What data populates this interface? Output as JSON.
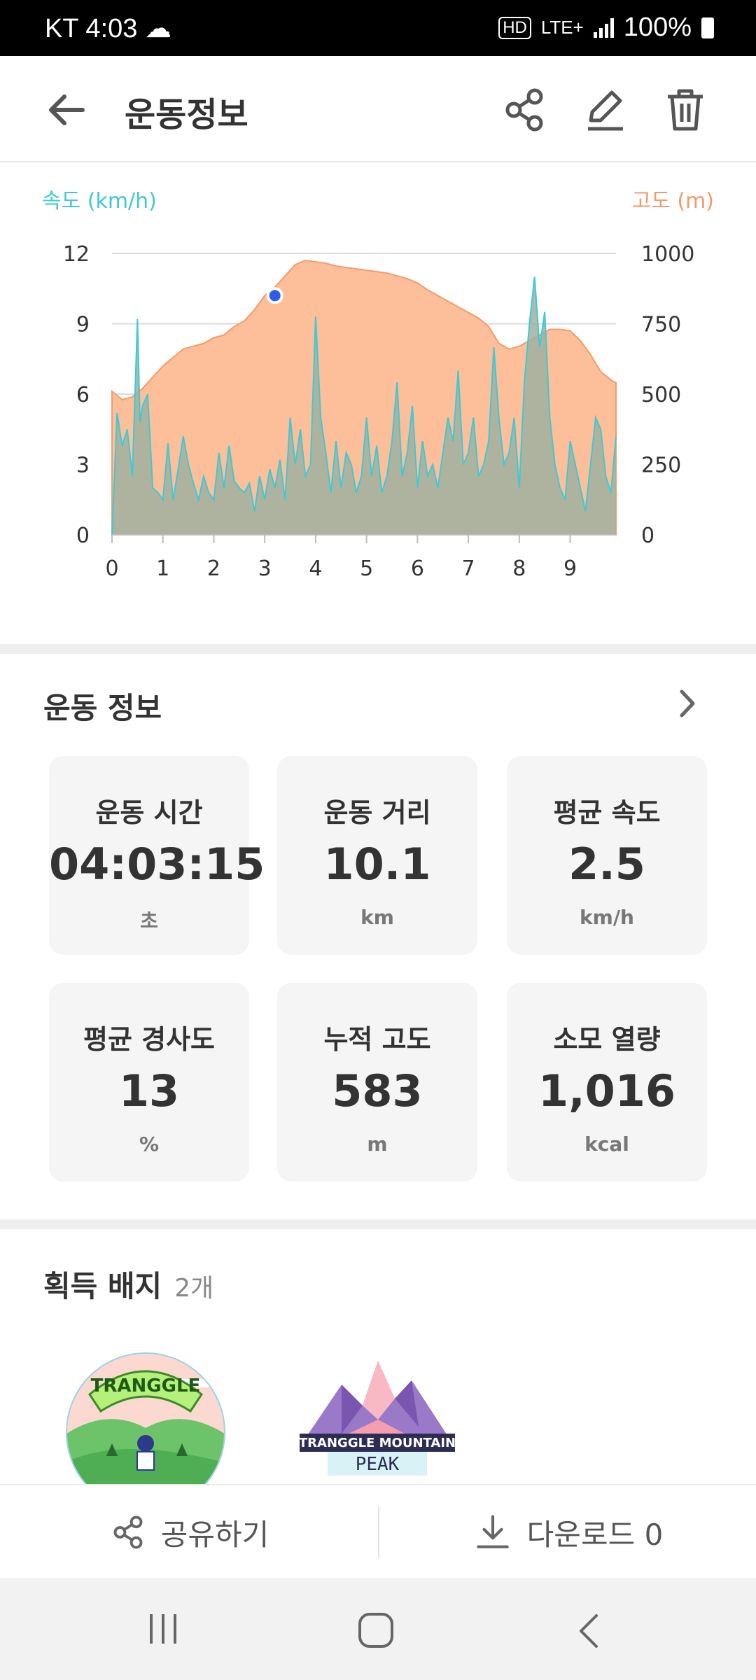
{
  "status_bar": {
    "carrier_time": "KT 4:03",
    "hd": "HD",
    "network": "LTE+",
    "battery": "100%"
  },
  "header": {
    "title": "운동정보",
    "back_icon": "arrow-left-icon",
    "share_icon": "share-icon",
    "edit_icon": "pencil-icon",
    "delete_icon": "trash-icon"
  },
  "chart_data": {
    "type": "area",
    "left_axis_label": "속도 (km/h)",
    "right_axis_label": "고도 (m)",
    "x_ticks": [
      "0",
      "1",
      "2",
      "3",
      "4",
      "5",
      "6",
      "7",
      "8",
      "9"
    ],
    "x_range": [
      0,
      9.9
    ],
    "left_ticks": [
      "0",
      "3",
      "6",
      "9",
      "12"
    ],
    "left_range": [
      0,
      12
    ],
    "right_ticks": [
      "0",
      "250",
      "500",
      "750",
      "1000"
    ],
    "right_range": [
      0,
      1000
    ],
    "colors": {
      "speed_line": "#3ec9d6",
      "speed_fill": "#9fb0a0",
      "altitude_fill": "#fdbf9a",
      "altitude_line": "#f49a6a",
      "marker": "#2f5bea"
    },
    "grid": true,
    "marker": {
      "x": 3.2,
      "altitude": 850
    },
    "series": [
      {
        "x": [
          0,
          0.2,
          0.4,
          0.6,
          0.8,
          1.0,
          1.2,
          1.4,
          1.6,
          1.8,
          2.0,
          2.2,
          2.4,
          2.6,
          2.8,
          3.0,
          3.2,
          3.4,
          3.6,
          3.8,
          4.0,
          4.2,
          4.4,
          4.6,
          4.8,
          5.0,
          5.2,
          5.4,
          5.6,
          5.8,
          6.0,
          6.2,
          6.4,
          6.6,
          6.8,
          7.0,
          7.2,
          7.4,
          7.6,
          7.8,
          8.0,
          8.2,
          8.4,
          8.6,
          8.8,
          9.0,
          9.2,
          9.4,
          9.6,
          9.8,
          9.9
        ],
        "values": [
          510,
          480,
          490,
          520,
          560,
          600,
          630,
          660,
          670,
          680,
          700,
          710,
          740,
          760,
          800,
          850,
          880,
          920,
          960,
          975,
          970,
          965,
          955,
          950,
          945,
          940,
          935,
          930,
          920,
          910,
          895,
          870,
          850,
          830,
          810,
          790,
          770,
          740,
          680,
          660,
          670,
          690,
          710,
          730,
          730,
          725,
          690,
          640,
          580,
          550,
          540
        ]
      },
      {
        "x": [
          0,
          0.1,
          0.2,
          0.3,
          0.4,
          0.5,
          0.55,
          0.6,
          0.7,
          0.8,
          0.9,
          1.0,
          1.1,
          1.2,
          1.3,
          1.4,
          1.5,
          1.6,
          1.7,
          1.8,
          1.9,
          2.0,
          2.1,
          2.2,
          2.3,
          2.4,
          2.5,
          2.6,
          2.7,
          2.8,
          2.9,
          3.0,
          3.1,
          3.2,
          3.3,
          3.4,
          3.5,
          3.6,
          3.7,
          3.8,
          3.9,
          4.0,
          4.1,
          4.2,
          4.3,
          4.4,
          4.5,
          4.6,
          4.7,
          4.8,
          4.9,
          5.0,
          5.1,
          5.2,
          5.3,
          5.4,
          5.5,
          5.6,
          5.7,
          5.8,
          5.9,
          6.0,
          6.1,
          6.2,
          6.3,
          6.4,
          6.5,
          6.6,
          6.7,
          6.8,
          6.9,
          7.0,
          7.1,
          7.2,
          7.3,
          7.4,
          7.5,
          7.6,
          7.7,
          7.8,
          7.9,
          8.0,
          8.1,
          8.2,
          8.3,
          8.4,
          8.5,
          8.6,
          8.7,
          8.8,
          8.9,
          9.0,
          9.1,
          9.2,
          9.3,
          9.4,
          9.5,
          9.6,
          9.7,
          9.8,
          9.9
        ],
        "values": [
          0,
          5.2,
          3.8,
          4.5,
          2.5,
          9.2,
          4.8,
          5.5,
          6.0,
          2.0,
          1.8,
          1.5,
          3.9,
          1.5,
          2.8,
          4.2,
          3.0,
          2.2,
          1.5,
          2.5,
          1.8,
          1.5,
          3.5,
          2.0,
          3.8,
          2.3,
          2.0,
          1.8,
          2.2,
          1.0,
          2.5,
          1.5,
          2.8,
          2.0,
          3.2,
          1.5,
          5.0,
          3.0,
          4.5,
          2.5,
          3.0,
          9.3,
          5.0,
          3.5,
          1.8,
          4.0,
          2.0,
          3.5,
          3.0,
          1.8,
          2.5,
          5.0,
          2.5,
          3.8,
          1.8,
          2.5,
          4.0,
          6.5,
          2.5,
          3.5,
          5.5,
          2.0,
          4.0,
          2.5,
          3.0,
          2.0,
          3.5,
          5.0,
          4.0,
          7.0,
          3.0,
          3.5,
          5.0,
          2.5,
          3.0,
          4.0,
          8.0,
          5.0,
          3.0,
          3.5,
          5.0,
          2.0,
          6.5,
          9.0,
          11.0,
          8.0,
          9.5,
          5.0,
          3.0,
          2.0,
          1.5,
          4.0,
          3.0,
          2.0,
          1.0,
          3.0,
          5.0,
          4.5,
          2.5,
          1.8,
          4.2
        ]
      }
    ]
  },
  "workout": {
    "section_title": "운동 정보",
    "chevron_icon": "chevron-right-icon",
    "cards": [
      {
        "label": "운동 시간",
        "value": "04:03:15",
        "unit": "초"
      },
      {
        "label": "운동 거리",
        "value": "10.1",
        "unit": "km"
      },
      {
        "label": "평균 속도",
        "value": "2.5",
        "unit": "km/h"
      },
      {
        "label": "평균 경사도",
        "value": "13",
        "unit": "%"
      },
      {
        "label": "누적 고도",
        "value": "583",
        "unit": "m"
      },
      {
        "label": "소모 열량",
        "value": "1,016",
        "unit": "kcal"
      }
    ]
  },
  "badges": {
    "section_title": "획득 배지",
    "count": "2개",
    "items": [
      {
        "name": "badge-tranggle-paraglide",
        "text": "TRANGGLE"
      },
      {
        "name": "badge-tranggle-mountain-peak",
        "text1": "TRANGGLE MOUNTAIN",
        "text2": "PEAK"
      }
    ]
  },
  "bottom_actions": {
    "share_label": "공유하기",
    "download_label": "다운로드 0"
  },
  "nav": {
    "recent_icon": "recent-apps-icon",
    "home_icon": "home-icon",
    "back_icon": "back-nav-icon"
  }
}
